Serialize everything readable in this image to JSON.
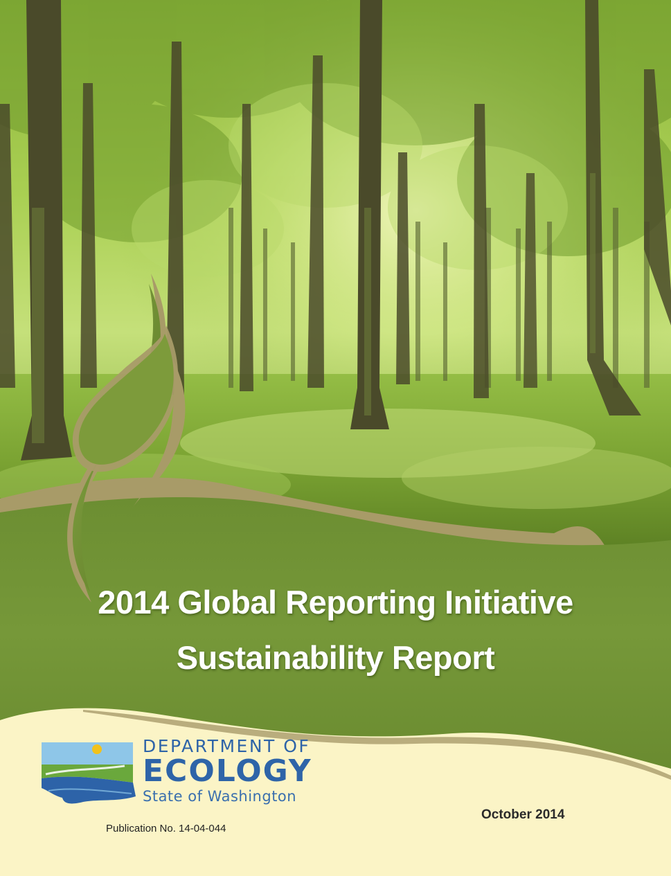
{
  "cover": {
    "title_line1": "2014 Global Reporting Initiative",
    "title_line2": "Sustainability Report",
    "date": "October 2014",
    "publication": "Publication No. 14-04-044"
  },
  "logo": {
    "line1": "DEPARTMENT OF",
    "line2": "ECOLOGY",
    "line3": "State of Washington"
  },
  "images": {
    "background_photo": "forest-photo",
    "decoration": "leaf-swoosh"
  },
  "colors": {
    "band_green": "#73943a",
    "leaf_green": "#6f8f33",
    "tan_accent": "#a79a6a",
    "cream": "#fbf4c6",
    "logo_blue": "#2e64a8",
    "logo_sky": "#8ec6e8",
    "logo_grass": "#6aa83c",
    "logo_water": "#2d63a8"
  }
}
